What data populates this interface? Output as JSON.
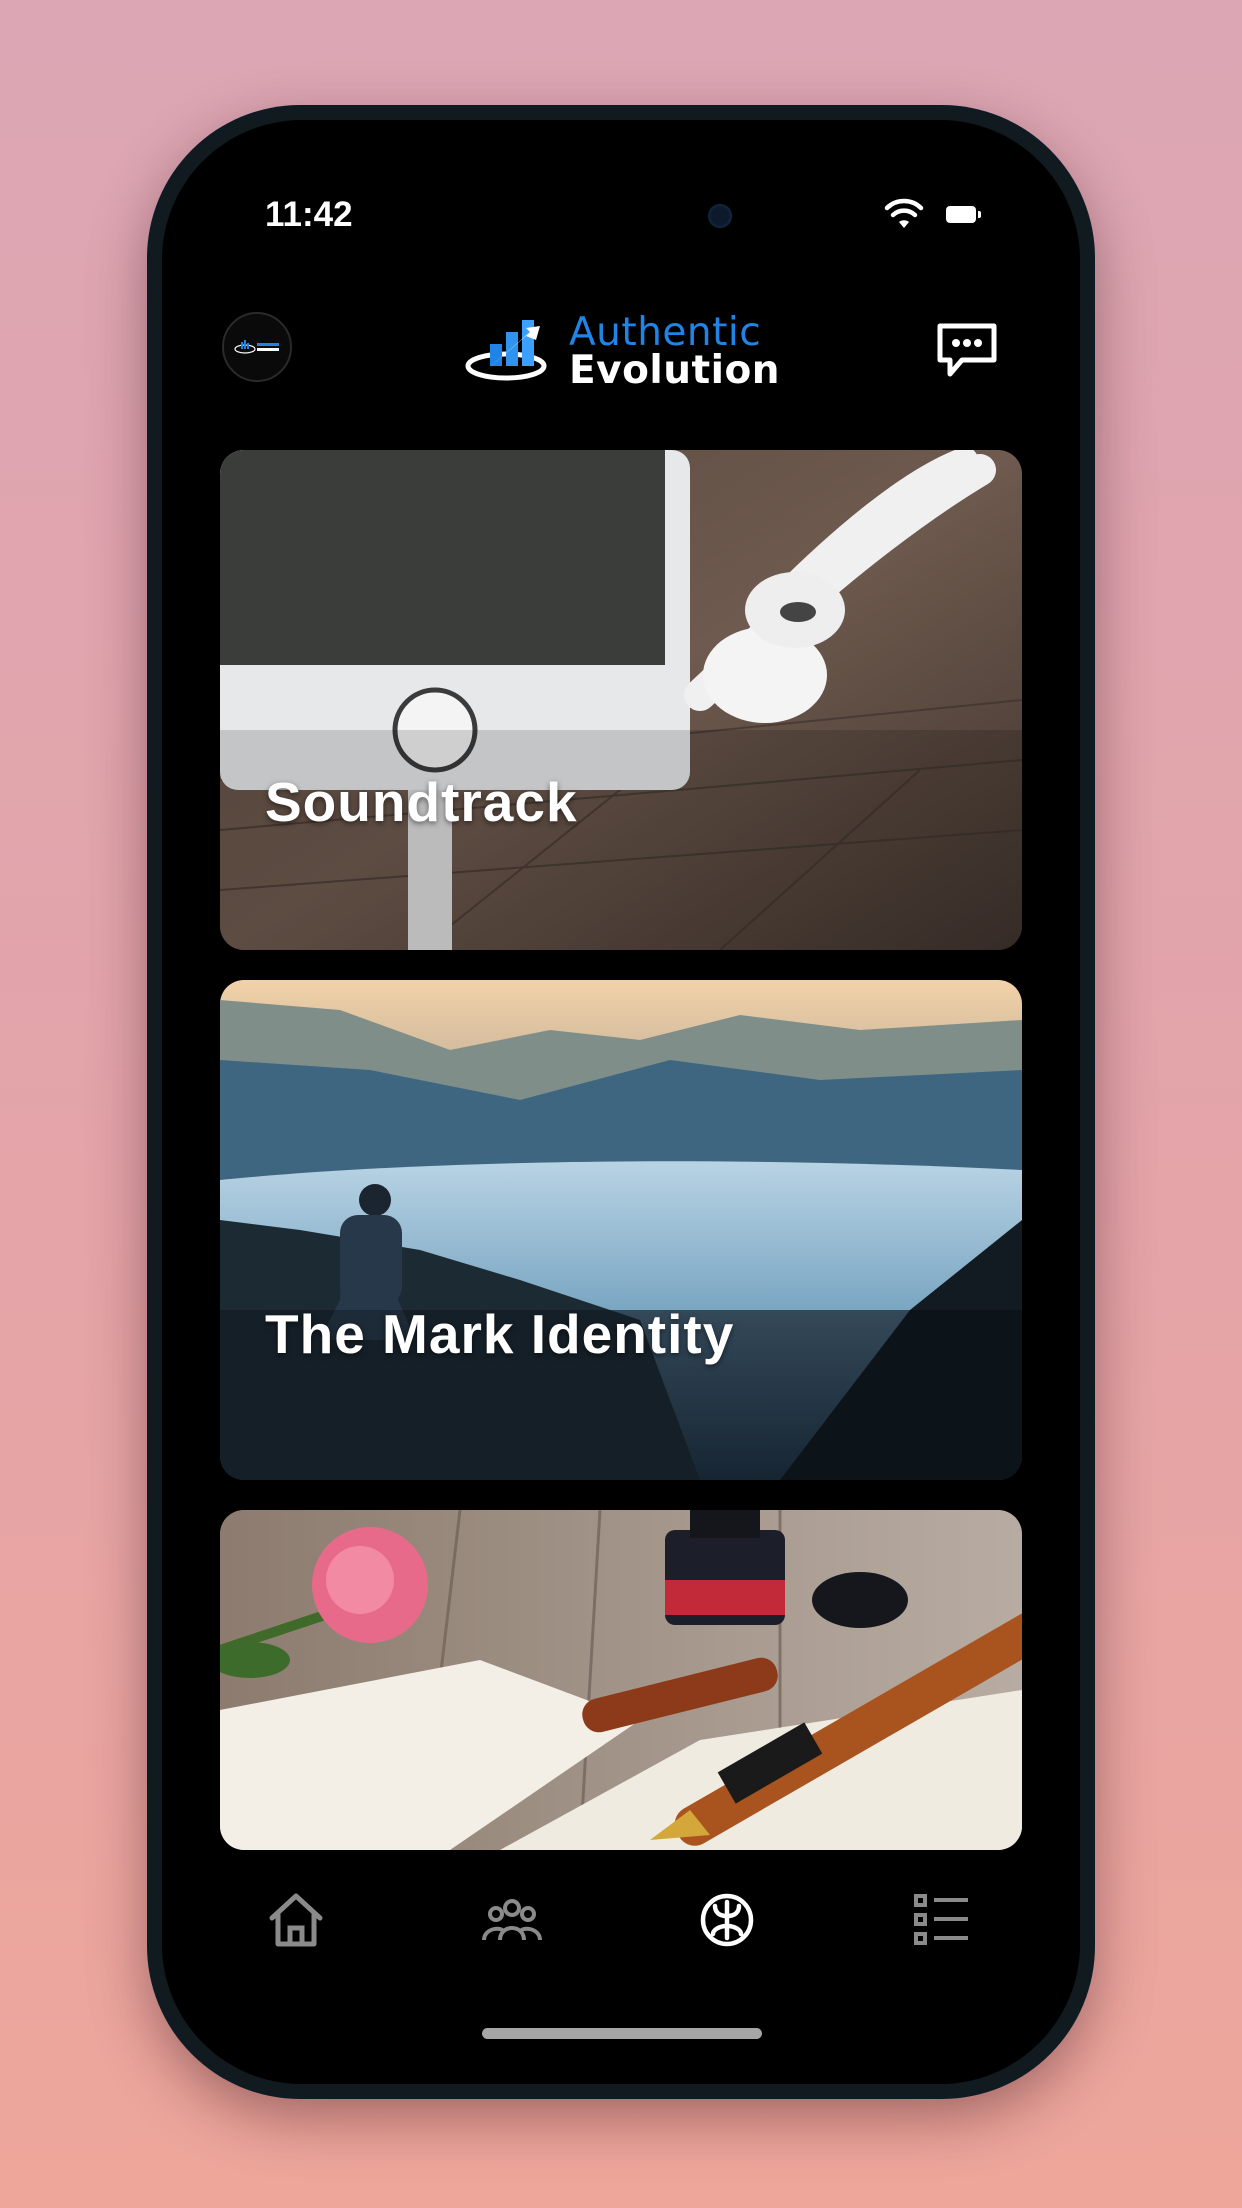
{
  "status_bar": {
    "time": "11:42"
  },
  "header": {
    "logo": {
      "line1": "Authentic",
      "line2": "Evolution"
    },
    "avatar_icon": "brand-avatar",
    "chat_icon": "chat-bubble-icon"
  },
  "cards": [
    {
      "title": "Soundtrack",
      "image": "phone and earphones on wood"
    },
    {
      "title": "The Mark Identity",
      "image": "man overlooking misty mountain valley"
    },
    {
      "title": "",
      "image": "fountain pen, ink bottle and rose on letters"
    }
  ],
  "tabbar": {
    "items": [
      {
        "icon": "home-icon",
        "active": false
      },
      {
        "icon": "community-icon",
        "active": false
      },
      {
        "icon": "brain-icon",
        "active": true
      },
      {
        "icon": "list-icon",
        "active": false
      }
    ]
  },
  "colors": {
    "accent": "#1f84e6",
    "background": "#000000",
    "tab_inactive": "#8a8a8a",
    "tab_active": "#ffffff"
  }
}
